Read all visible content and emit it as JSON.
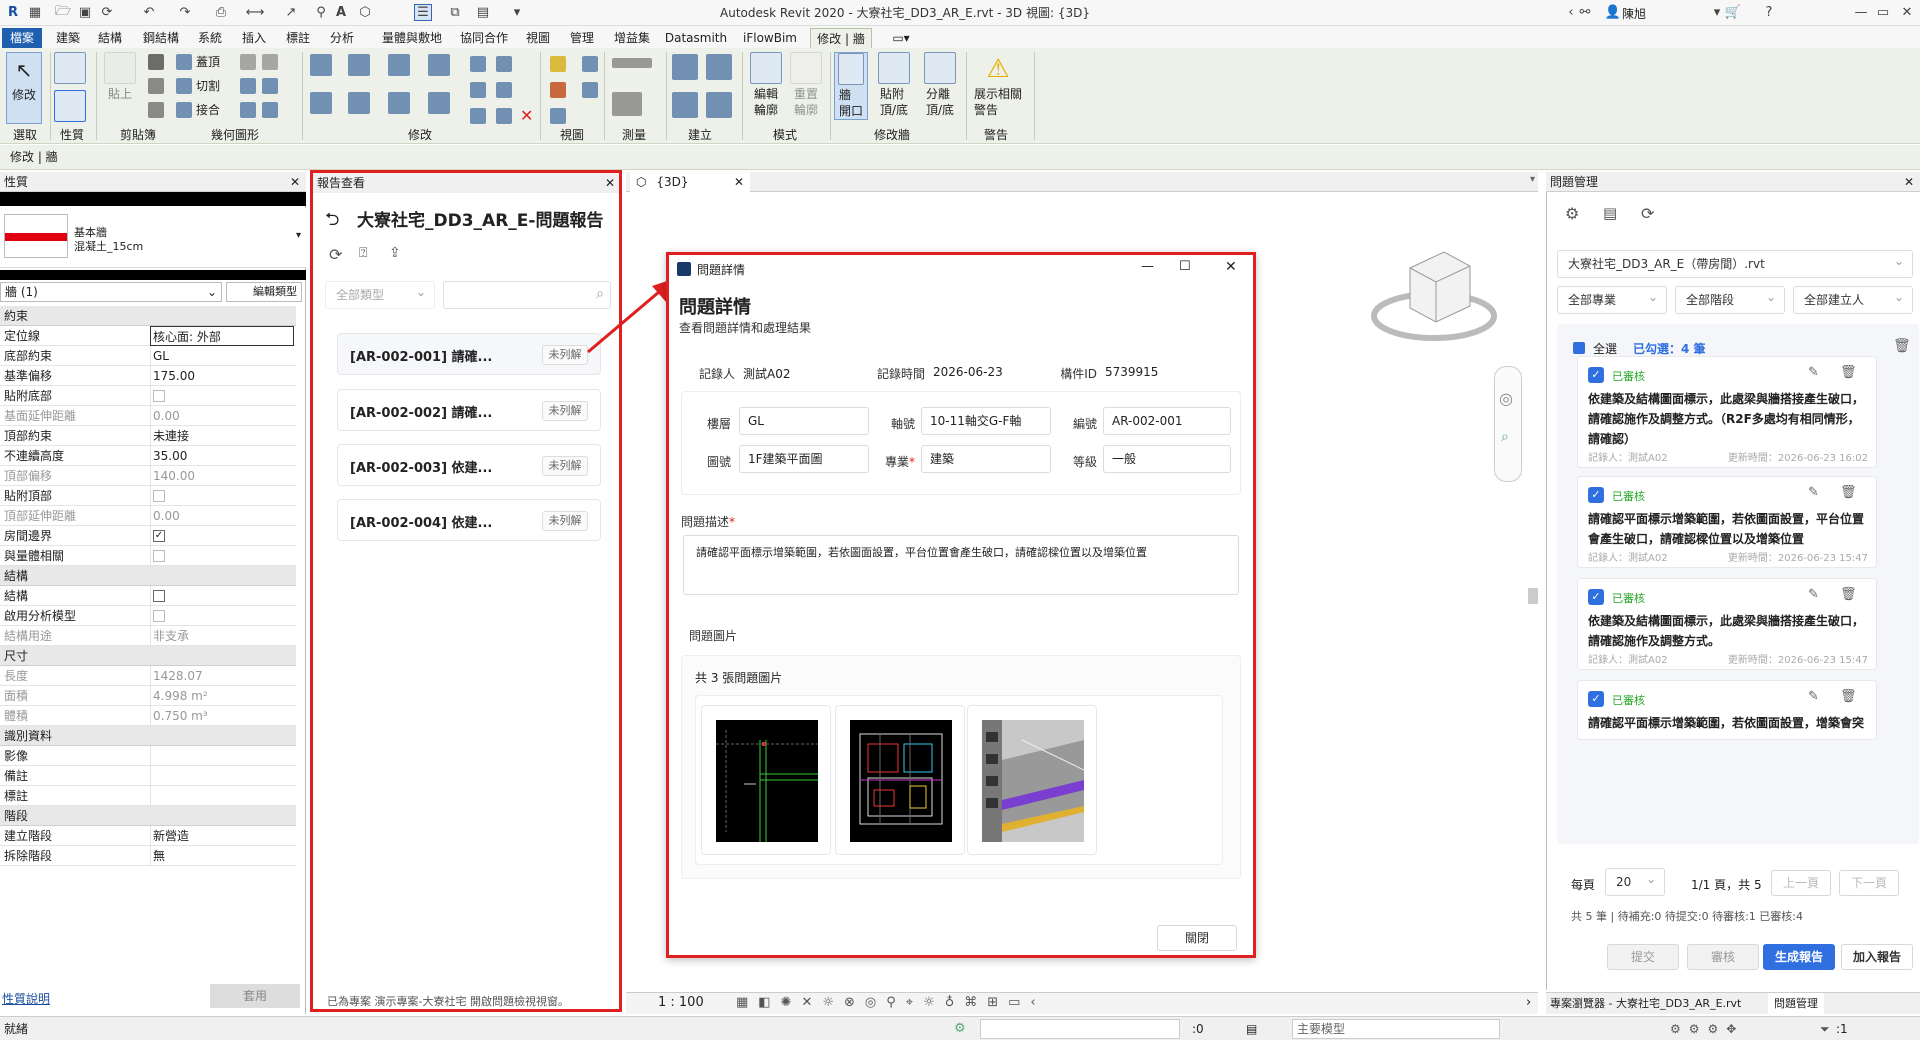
{
  "window": {
    "title": "Autodesk Revit 2020 - 大寮社宅_DD3_AR_E.rvt - 3D 視圖: {3D}",
    "user": "陳旭",
    "min": "—",
    "restore": "▭",
    "close": "✕"
  },
  "tabs": [
    "檔案",
    "建築",
    "結構",
    "鋼結構",
    "系統",
    "插入",
    "標註",
    "分析",
    "量體與敷地",
    "協同合作",
    "視圖",
    "管理",
    "增益集",
    "Datasmith",
    "iFlowBim",
    "修改 | 牆"
  ],
  "ribbon": {
    "buttons": {
      "modify": "修改",
      "edit_type": "性質",
      "paste": "貼上",
      "edit_profile": "編輯\n輪廓",
      "reset_profile": "重置\n輪廓",
      "wall_opening": "牆\n開口",
      "attach": "貼附\n頂/底",
      "detach": "分離\n頂/底",
      "show_warn": "展示相關\n警告"
    },
    "small": {
      "cope": "蓋頂",
      "cut": "切割",
      "join": "接合"
    },
    "groups": {
      "select": "選取",
      "props": "性質",
      "clipboard": "剪貼簿",
      "geometry": "幾何圖形",
      "modify": "修改",
      "view": "視圖",
      "measure": "測量",
      "create": "建立",
      "mode": "模式",
      "modify_wall": "修改牆",
      "warning": "警告"
    }
  },
  "modebar": "修改 | 牆",
  "props": {
    "header": "性質",
    "type_family": "基本牆",
    "type_name": "混凝土_15cm",
    "selector": "牆 (1)",
    "edit_type": "編輯類型",
    "sections": [
      {
        "name": "約束",
        "rows": [
          [
            "定位線",
            "核心面: 外部",
            ""
          ],
          [
            "底部約束",
            "GL",
            ""
          ],
          [
            "基準偏移",
            "175.00",
            ""
          ],
          [
            "貼附底部",
            "",
            "cb-dis"
          ],
          [
            "基面延伸距離",
            "0.00",
            "grey"
          ],
          [
            "頂部約束",
            "未連接",
            ""
          ],
          [
            "不連續高度",
            "35.00",
            ""
          ],
          [
            "頂部偏移",
            "140.00",
            "grey"
          ],
          [
            "貼附頂部",
            "",
            "cb-dis"
          ],
          [
            "頂部延伸距離",
            "0.00",
            "grey"
          ],
          [
            "房間邊界",
            "",
            "cb-on"
          ],
          [
            "與量體相關",
            "",
            "cb-dis"
          ]
        ]
      },
      {
        "name": "結構",
        "rows": [
          [
            "結構",
            "",
            "cb"
          ],
          [
            "啟用分析模型",
            "",
            "cb-dis"
          ],
          [
            "結構用途",
            "非支承",
            "grey"
          ]
        ]
      },
      {
        "name": "尺寸",
        "rows": [
          [
            "長度",
            "1428.07",
            "grey"
          ],
          [
            "面積",
            "4.998 m²",
            "grey"
          ],
          [
            "體積",
            "0.750 m³",
            "grey"
          ]
        ]
      },
      {
        "name": "識別資料",
        "rows": [
          [
            "影像",
            "",
            ""
          ],
          [
            "備註",
            "",
            ""
          ],
          [
            "標註",
            "",
            ""
          ]
        ]
      },
      {
        "name": "階段",
        "rows": [
          [
            "建立階段",
            "新營造",
            ""
          ],
          [
            "拆除階段",
            "無",
            ""
          ]
        ]
      }
    ],
    "help": "性質說明",
    "apply": "套用"
  },
  "report": {
    "header": "報告查看",
    "title": "大寮社宅_DD3_AR_E-問題報告",
    "filter": "全部類型",
    "search_placeholder": "",
    "items": [
      {
        "id": "[AR-002-001] 請確...",
        "status": "未列解"
      },
      {
        "id": "[AR-002-002] 請確...",
        "status": "未列解"
      },
      {
        "id": "[AR-002-003] 依建...",
        "status": "未列解"
      },
      {
        "id": "[AR-002-004] 依建...",
        "status": "未列解"
      }
    ],
    "footer": "已為專案 演示專案-大寮社宅 開啟問題檢視視窗。"
  },
  "viewtab": {
    "label": "{3D}"
  },
  "dialog": {
    "title": "問題詳情",
    "heading": "問題詳情",
    "sub": "查看問題詳情和處理結果",
    "recorder_l": "記錄人",
    "recorder": "測試A02",
    "time_l": "記錄時間",
    "time": "2026-06-23",
    "elem_l": "構件ID",
    "elem": "5739915",
    "floor_l": "樓層",
    "floor": "GL",
    "axis_l": "軸號",
    "axis": "10-11軸交G-F軸",
    "code_l": "編號",
    "code": "AR-002-001",
    "drawing_l": "圖號",
    "drawing": "1F建築平面圖",
    "spec_l": "專業",
    "spec": "建築",
    "level_l": "等級",
    "level": "一般",
    "desc_l": "問題描述",
    "desc": "請確認平面標示增築範圍，若依圖面設置，平台位置會產生破口，請確認樑位置以及增築位置",
    "img_l": "問題圖片",
    "img_count": "共 3 張問題圖片",
    "close": "關閉"
  },
  "issues": {
    "header": "問題管理",
    "file": "大寮社宅_DD3_AR_E（帶房間）.rvt",
    "f1": "全部專業",
    "f2": "全部階段",
    "f3": "全部建立人",
    "select_all": "全選",
    "selected": "已勾選：4 筆",
    "cards": [
      {
        "status": "已審核",
        "body": "依建築及結構圖面標示，此處梁與牆搭接產生破口，請確認施作及調整方式。（R2F多處均有相同情形，請確認）",
        "recorder": "記錄人：測試A02",
        "updated": "更新時間：2026-06-23 16:02"
      },
      {
        "status": "已審核",
        "body": "請確認平面標示增築範圍，若依圖面設置，平台位置會產生破口，請確認樑位置以及增築位置",
        "recorder": "記錄人：測試A02",
        "updated": "更新時間：2026-06-23 15:47"
      },
      {
        "status": "已審核",
        "body": "依建築及結構圖面標示，此處梁與牆搭接產生破口，請確認施作及調整方式。",
        "recorder": "記錄人：測試A02",
        "updated": "更新時間：2026-06-23 15:47"
      },
      {
        "status": "已審核",
        "body": "請確認平面標示增築範圍，若依圖面設置，增築會突",
        "recorder": "",
        "updated": ""
      }
    ],
    "per_page_l": "每頁",
    "per_page": "20",
    "pages": "1/1 頁，共 5",
    "prev": "上一頁",
    "next": "下一頁",
    "summary": "共 5 筆 | 待補充:0 待提交:0 待審核:1 已審核:4",
    "submit": "提交",
    "review": "審核",
    "generate": "生成報告",
    "add": "加入報告",
    "tab1": "專案瀏覽器 - 大寮社宅_DD3_AR_E.rvt",
    "tab2": "問題管理"
  },
  "viewbar": {
    "scale": "1 : 100"
  },
  "statusbar": {
    "left": "就緒",
    "count": ":0",
    "model": "主要模型",
    "filter": ":1"
  },
  "colors": {
    "accent": "#2f6fe0",
    "highlight": "#e02020",
    "ok": "#2aa52a"
  }
}
